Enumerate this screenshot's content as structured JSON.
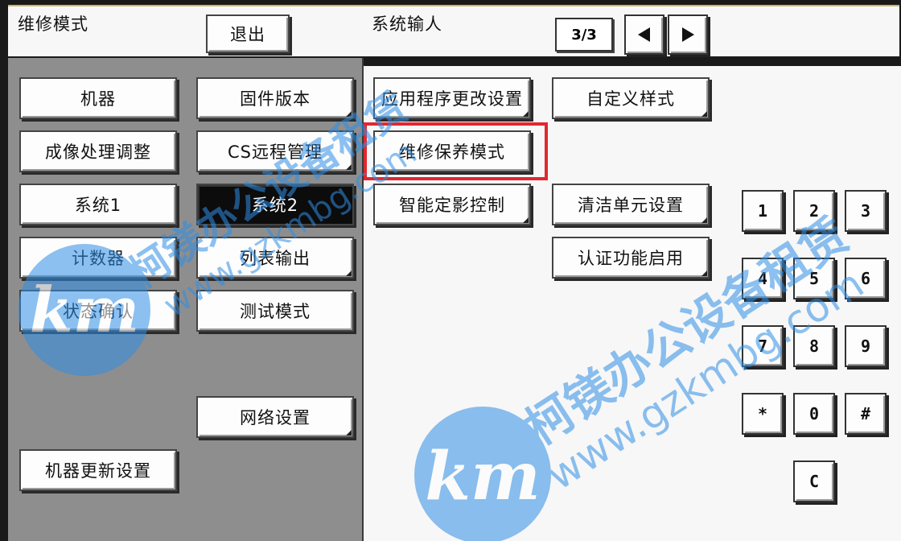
{
  "header": {
    "title": "维修模式",
    "exit_label": "退出",
    "section_title": "系统输人",
    "page_indicator": "3/3"
  },
  "left_menu": {
    "col1": [
      "机器",
      "成像处理调整",
      "系统1",
      "计数器",
      "状态确认",
      "机器更新设置"
    ],
    "col2": [
      "固件版本",
      "CS远程管理",
      "系统2",
      "列表输出",
      "测试模式",
      "网络设置"
    ],
    "selected": "系统2"
  },
  "right_menu": {
    "col1": [
      "应用程序更改设置",
      "维修保养模式",
      "智能定影控制"
    ],
    "col2": [
      "自定义样式",
      "清洁单元设置",
      "认证功能启用"
    ],
    "highlighted": "维修保养模式"
  },
  "keypad": {
    "keys": [
      "1",
      "2",
      "3",
      "4",
      "5",
      "6",
      "7",
      "8",
      "9",
      "*",
      "0",
      "#",
      "C"
    ]
  },
  "watermark": {
    "brand_text": "柯镁办公设备租赁",
    "url_text": "www.gzkmbg.com",
    "logo_text": "km",
    "color": "#2f8fe6"
  },
  "colors": {
    "highlight_border": "#e0282e",
    "left_panel_bg": "#8e8e8e",
    "selected_button_bg": "#0c0c0c"
  }
}
